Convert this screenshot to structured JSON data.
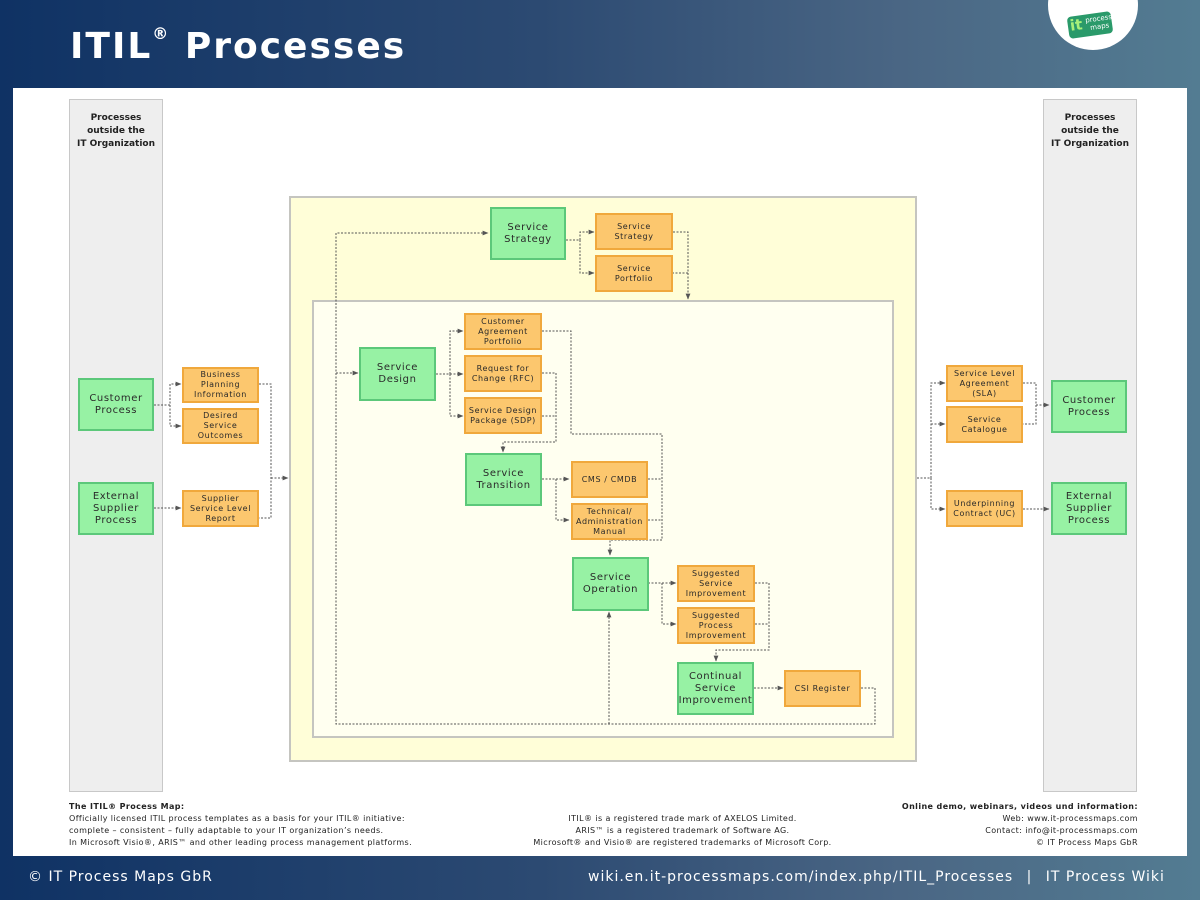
{
  "header": {
    "title": "ITIL",
    "title_sup": "®",
    "title_rest": " Processes",
    "logo": {
      "it": "it",
      "text": "process\nmaps",
      "icon": "it-process-maps-logo"
    }
  },
  "colors": {
    "process_fill": "#97f2a4",
    "process_border": "#5cc87a",
    "artifact_fill": "#fcc76e",
    "artifact_border": "#f0a83c",
    "outer_zone": "#fffed8",
    "inner_zone": "#fffff0",
    "side_column": "#eeeeee"
  },
  "columns": {
    "left_title": "Processes\noutside the\nIT Organization",
    "right_title": "Processes\noutside the\nIT Organization"
  },
  "processes": {
    "customer_left": "Customer\nProcess",
    "supplier_left": "External\nSupplier\nProcess",
    "service_strategy": "Service\nStrategy",
    "service_design": "Service\nDesign",
    "service_transition": "Service\nTransition",
    "service_operation": "Service\nOperation",
    "csi": "Continual\nService\nImprovement",
    "customer_right": "Customer\nProcess",
    "supplier_right": "External\nSupplier\nProcess"
  },
  "artifacts": {
    "business_planning": "Business\nPlanning\nInformation",
    "desired_outcomes": "Desired\nService\nOutcomes",
    "supplier_slr": "Supplier\nService Level\nReport",
    "strategy_doc": "Service\nStrategy",
    "portfolio": "Service\nPortfolio",
    "cap": "Customer\nAgreement\nPortfolio",
    "rfc": "Request for\nChange (RFC)",
    "sdp": "Service Design\nPackage (SDP)",
    "cmdb": "CMS / CMDB",
    "tech_manual": "Technical/\nAdministration\nManual",
    "ssi": "Suggested\nService\nImprovement",
    "spi": "Suggested\nProcess\nImprovement",
    "csi_register": "CSI Register",
    "sla": "Service Level\nAgreement\n(SLA)",
    "catalogue": "Service\nCatalogue",
    "uc": "Underpinning\nContract (UC)"
  },
  "footer": {
    "left_heading": "The ITIL® Process Map:",
    "left_body": "Officially licensed ITIL process templates as a basis for your ITIL® initiative:\ncomplete – consistent – fully adaptable to your IT organization’s needs.\nIn Microsoft Visio®, ARIS™ and other leading process management platforms.",
    "center": "ITIL® is a registered trade mark of AXELOS Limited.\nARIS™ is a  registered trademark of Software AG.\nMicrosoft® and Visio® are registered trademarks of Microsoft Corp.",
    "right_heading": "Online demo, webinars, videos und information:",
    "right_body": "Web: www.it-processmaps.com\nContact: info@it-processmaps.com\n© IT Process Maps GbR"
  },
  "bottom_bar": {
    "copyright": "© IT Process Maps GbR",
    "url": "wiki.en.it-processmaps.com/index.php/ITIL_Processes",
    "separator": "|",
    "site": "IT Process Wiki"
  }
}
